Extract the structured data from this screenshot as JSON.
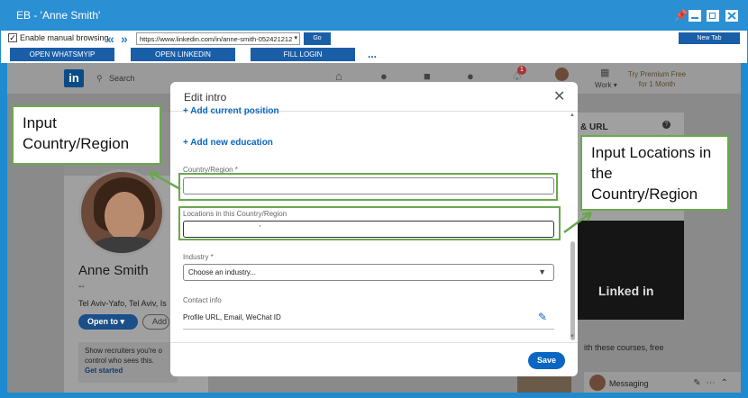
{
  "window": {
    "title": "EB - 'Anne Smith'",
    "pin_icon": "pin-icon",
    "minimize_icon": "minimize-icon",
    "restore_icon": "restore-icon",
    "close_icon": "close-icon"
  },
  "toolbar": {
    "manual_browsing_label": "Enable manual browsing",
    "manual_browsing_checked": true,
    "back_arrow": "«",
    "forward_arrow": "»",
    "url": "https://www.linkedin.com/in/anne-smith-052421212",
    "go_label": "Go",
    "new_tab_label": "New Tab",
    "buttons": [
      "OPEN WHATSMYIP",
      "OPEN LINKEDIN",
      "FILL LOGIN"
    ],
    "more_label": "..."
  },
  "linkedin": {
    "logo": "in",
    "search_placeholder": "Search",
    "work_label": "Work ▾",
    "premium_text": "Try Premium Free for 1 Month",
    "notification_count": "1",
    "profile": {
      "name": "Anne Smith",
      "headline": "--",
      "location": "Tel Aviv-Yafo, Tel Aviv, Is",
      "open_to_label": "Open to ▾",
      "add_label": "Add",
      "recruiter_text": "Show recruiters you're o control who sees this.",
      "get_started": "Get started"
    },
    "right_panel": {
      "title": "& URL",
      "ad_brand": "Linked in",
      "courses_text": "ith these courses, free"
    },
    "messaging_label": "Messaging"
  },
  "modal": {
    "title": "Edit intro",
    "add_position": "+ Add current position",
    "add_education": "+ Add new education",
    "country_label": "Country/Region *",
    "country_value": "",
    "locations_label": "Locations in this Country/Region",
    "locations_value": "'",
    "industry_label": "Industry *",
    "industry_value": "Choose an industry...",
    "contact_label": "Contact info",
    "contact_value": "Profile URL, Email, WeChat ID",
    "save_label": "Save"
  },
  "annotations": {
    "country_callout": "Input Country/Region",
    "locations_callout": "Input Locations in the Country/Region",
    "color": "#6aa84f"
  }
}
